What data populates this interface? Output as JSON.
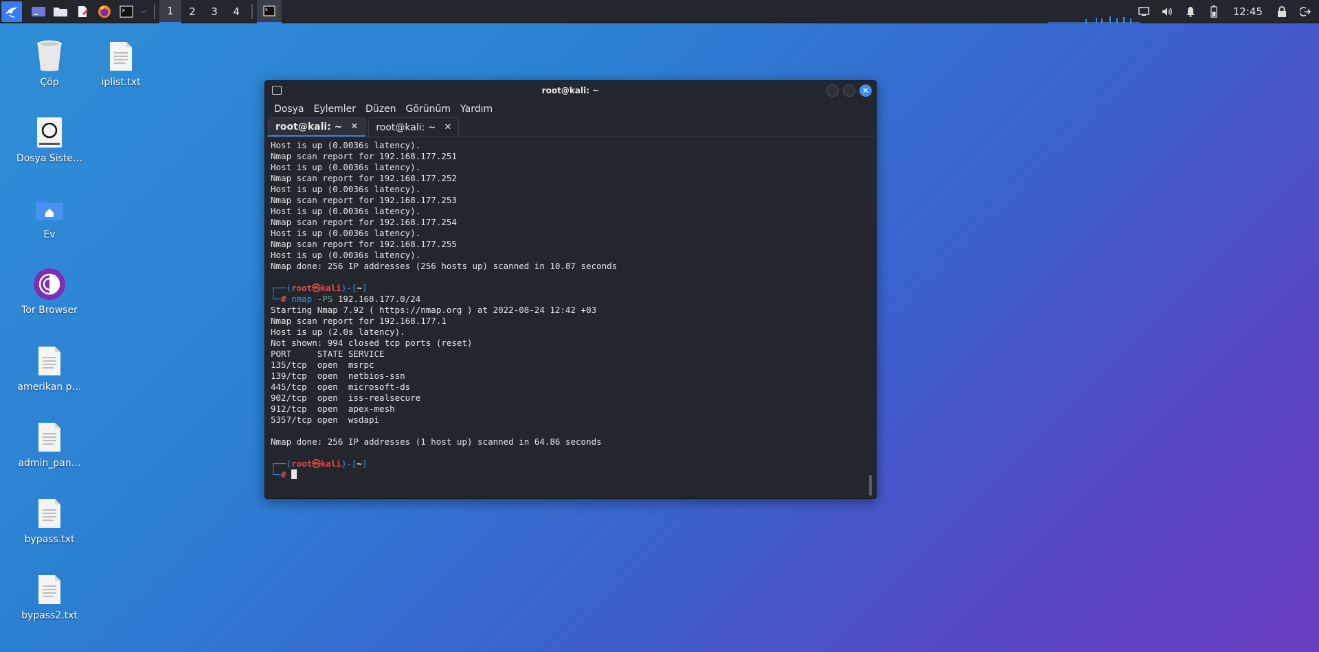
{
  "taskbar": {
    "workspaces": [
      "1",
      "2",
      "3",
      "4"
    ],
    "active_workspace": 0,
    "clock": "12:45"
  },
  "desktop": {
    "icons": [
      {
        "label": "Çöp",
        "icon": "trash-icon"
      },
      {
        "label": "iplist.txt",
        "icon": "text-file-icon"
      },
      {
        "label": "Dosya Siste…",
        "icon": "drive-icon"
      },
      {
        "label": "Ev",
        "icon": "home-folder-icon"
      },
      {
        "label": "Tor Browser",
        "icon": "tor-browser-icon"
      },
      {
        "label": "amerikan p…",
        "icon": "text-file-icon"
      },
      {
        "label": "admin_pan…",
        "icon": "text-file-icon"
      },
      {
        "label": "bypass.txt",
        "icon": "text-file-icon"
      },
      {
        "label": "bypass2.txt",
        "icon": "text-file-icon"
      }
    ]
  },
  "terminal": {
    "title": "root@kali: ~",
    "menu": [
      "Dosya",
      "Eylemler",
      "Düzen",
      "Görünüm",
      "Yardım"
    ],
    "tabs": [
      {
        "label": "root@kali: ~",
        "active": true
      },
      {
        "label": "root@kali: ~",
        "active": false
      }
    ],
    "output_top": [
      "Host is up (0.0036s latency).",
      "Nmap scan report for 192.168.177.251",
      "Host is up (0.0036s latency).",
      "Nmap scan report for 192.168.177.252",
      "Host is up (0.0036s latency).",
      "Nmap scan report for 192.168.177.253",
      "Host is up (0.0036s latency).",
      "Nmap scan report for 192.168.177.254",
      "Host is up (0.0036s latency).",
      "Nmap scan report for 192.168.177.255",
      "Host is up (0.0036s latency).",
      "Nmap done: 256 IP addresses (256 hosts up) scanned in 10.87 seconds"
    ],
    "prompt": {
      "open": "┌──(",
      "user": "root",
      "at": "㉿",
      "host": "kali",
      "mid": ")-[",
      "dir": "~",
      "close": "]",
      "second": "└─",
      "hash": "#"
    },
    "command": {
      "cmd": "nmap",
      "flag": "-PS",
      "arg": "192.168.177.0/24"
    },
    "output_bottom": [
      "Starting Nmap 7.92 ( https://nmap.org ) at 2022-08-24 12:42 +03",
      "Nmap scan report for 192.168.177.1",
      "Host is up (2.0s latency).",
      "Not shown: 994 closed tcp ports (reset)",
      "PORT     STATE SERVICE",
      "135/tcp  open  msrpc",
      "139/tcp  open  netbios-ssn",
      "445/tcp  open  microsoft-ds",
      "902/tcp  open  iss-realsecure",
      "912/tcp  open  apex-mesh",
      "5357/tcp open  wsdapi",
      "",
      "Nmap done: 256 IP addresses (1 host up) scanned in 64.86 seconds"
    ]
  }
}
